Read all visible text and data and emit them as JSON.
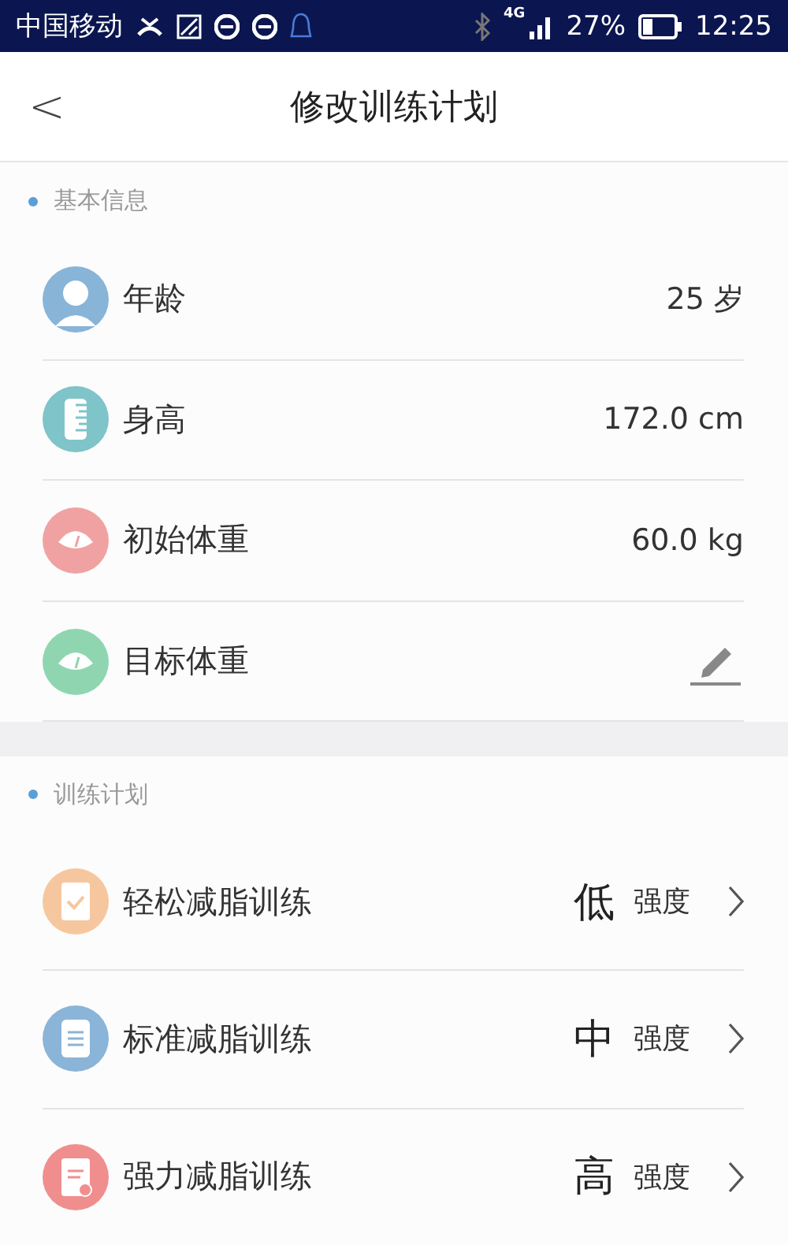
{
  "status_bar": {
    "carrier": "中国移动",
    "network": "4G",
    "battery": "27%",
    "time": "12:25"
  },
  "header": {
    "back": "<",
    "title": "修改训练计划"
  },
  "sections": [
    {
      "title": "基本信息",
      "rows": [
        {
          "kind": "value",
          "color": "#88b4d8",
          "label": "年龄",
          "value": "25 岁"
        },
        {
          "kind": "value",
          "color": "#7ec4c8",
          "label": "身高",
          "value": "172.0 cm"
        },
        {
          "kind": "value",
          "color": "#f0a2a2",
          "label": "初始体重",
          "value": "60.0 kg"
        },
        {
          "kind": "edit",
          "color": "#8fd6b0",
          "label": "目标体重"
        }
      ]
    },
    {
      "title": "训练计划",
      "rows": [
        {
          "kind": "plan",
          "color": "#f6c79e",
          "label": "轻松减脂训练",
          "level": "低",
          "unit": "强度"
        },
        {
          "kind": "plan",
          "color": "#8ab4d8",
          "label": "标准减脂训练",
          "level": "中",
          "unit": "强度"
        },
        {
          "kind": "plan",
          "color": "#f08e8e",
          "label": "强力减脂训练",
          "level": "高",
          "unit": "强度"
        }
      ]
    }
  ]
}
